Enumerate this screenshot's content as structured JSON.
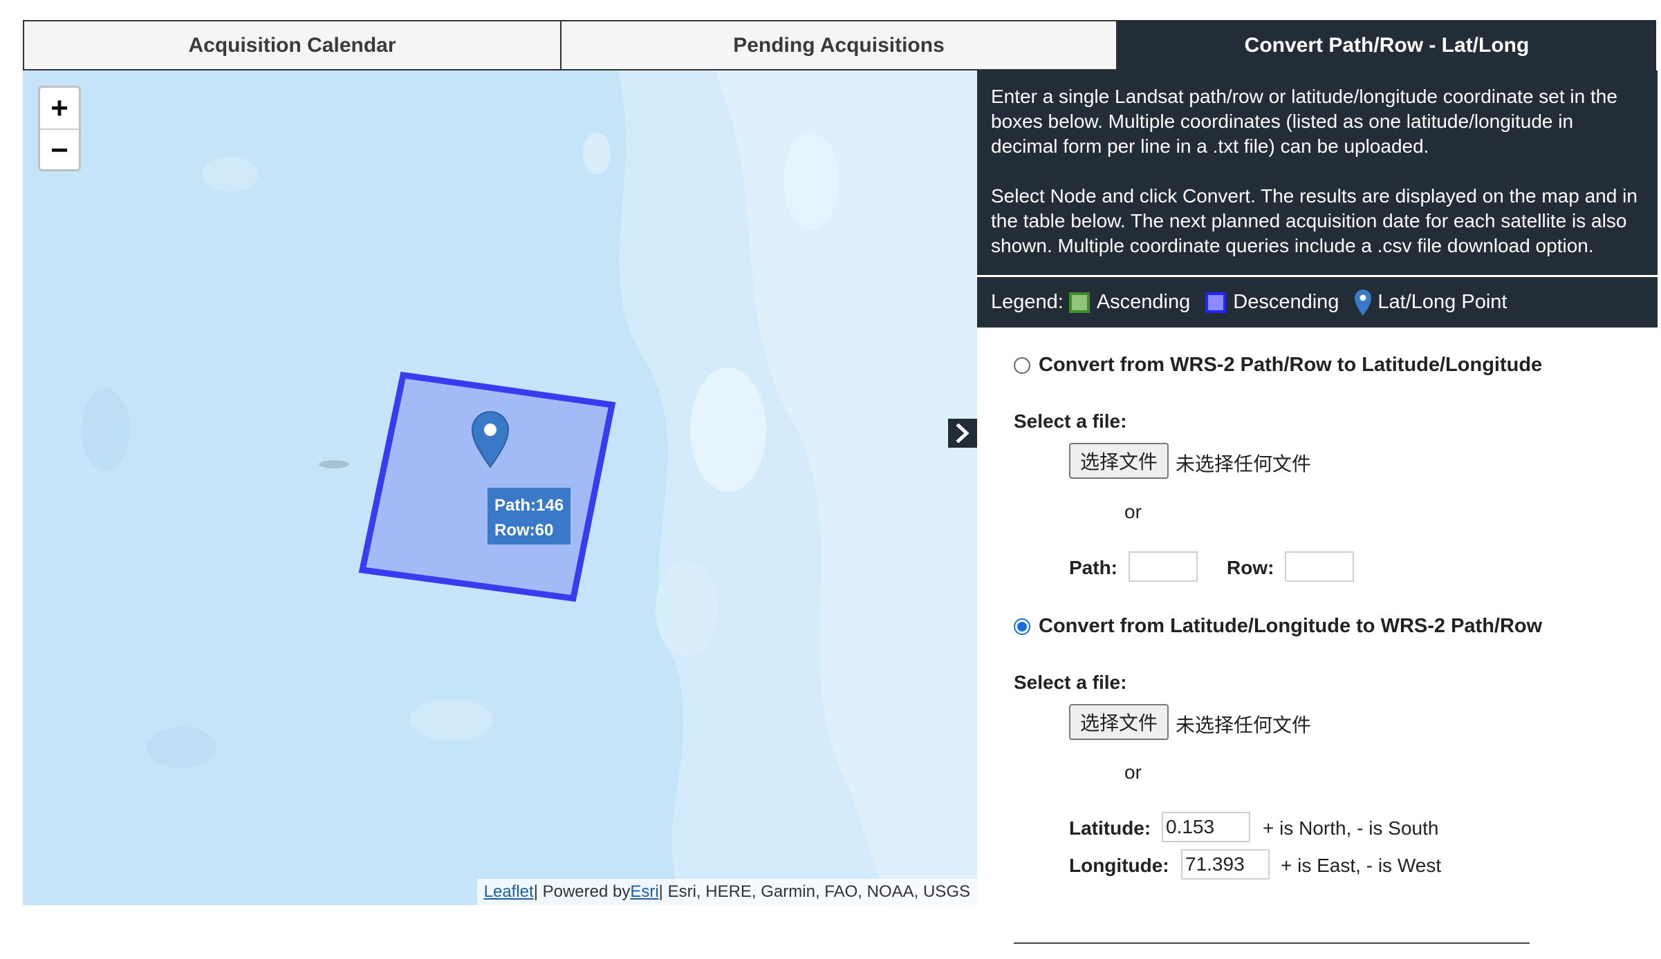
{
  "tabs": [
    {
      "label": "Acquisition Calendar",
      "active": false
    },
    {
      "label": "Pending Acquisitions",
      "active": false
    },
    {
      "label": "Convert Path/Row - Lat/Long",
      "active": true
    }
  ],
  "map": {
    "zoom_in_label": "+",
    "zoom_out_label": "−",
    "marker_label": {
      "path": "Path:146",
      "row": "Row:60"
    },
    "attribution": {
      "leaflet_link": "Leaflet",
      "sep1": " | Powered by ",
      "esri_link": "Esri",
      "rest": " | Esri, HERE, Garmin, FAO, NOAA, USGS"
    },
    "collapse_icon": "chevron-right-icon",
    "colors": {
      "water": "#c6e4f7",
      "polygon_fill": "#9db5f5",
      "polygon_stroke": "#3a3af0",
      "marker": "#3a79c8"
    }
  },
  "panel": {
    "info_p1": "Enter a single Landsat path/row or latitude/longitude coordinate set in the boxes below. Multiple coordinates (listed as one latitude/longitude in decimal form per line in a .txt file) can be uploaded.",
    "info_p2": "Select Node and click Convert. The results are displayed on the map and in the table below. The next planned acquisition date for each satellite is also shown. Multiple coordinate queries include a .csv file download option.",
    "legend": {
      "title": "Legend:",
      "ascending": "Ascending",
      "descending": "Descending",
      "point": "Lat/Long Point"
    },
    "section_pr": {
      "radio_label": "Convert from WRS-2 Path/Row to Latitude/Longitude",
      "checked": false,
      "select_file": "Select a file:",
      "file_button": "选择文件",
      "file_none": "未选择任何文件",
      "or": "or",
      "path_label": "Path:",
      "path_value": "",
      "row_label": "Row:",
      "row_value": ""
    },
    "section_ll": {
      "radio_label": "Convert from Latitude/Longitude to WRS-2 Path/Row",
      "checked": true,
      "select_file": "Select a file:",
      "file_button": "选择文件",
      "file_none": "未选择任何文件",
      "or": "or",
      "lat_label": "Latitude:",
      "lat_value": "0.153",
      "lat_hint": "+ is North, - is South",
      "lon_label": "Longitude:",
      "lon_value": "71.393",
      "lon_hint": "+ is East, - is West"
    }
  }
}
